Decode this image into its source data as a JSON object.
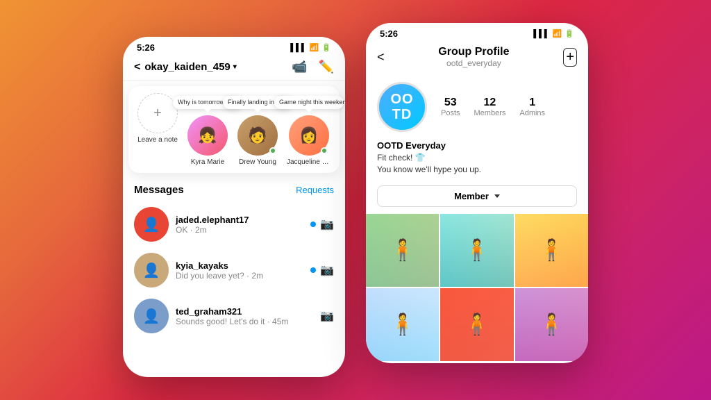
{
  "background": "instagram-gradient",
  "left_phone": {
    "status_bar": {
      "time": "5:26",
      "signal": "▌▌▌",
      "wifi": "WiFi",
      "battery": "Battery"
    },
    "header": {
      "back_label": "<",
      "username": "okay_kaiden_459",
      "dropdown_arrow": "▾",
      "video_icon": "video-camera",
      "compose_icon": "compose"
    },
    "stories": [
      {
        "id": "add",
        "label": "Leave a note",
        "type": "add"
      },
      {
        "id": "kyra",
        "label": "Kyra Marie",
        "note": "Why is tomorrow Monday!? 😅",
        "online": false,
        "avatar_color": "pink"
      },
      {
        "id": "drew",
        "label": "Drew Young",
        "note": "Finally landing in NYC! ❤️",
        "online": true,
        "avatar_color": "brown"
      },
      {
        "id": "jacqueline",
        "label": "Jacqueline Lam",
        "note": "Game night this weekend? 🎮",
        "online": true,
        "avatar_color": "orange"
      }
    ],
    "messages_header": {
      "title": "Messages",
      "requests": "Requests"
    },
    "messages": [
      {
        "username": "jaded.elephant17",
        "preview": "OK · 2m",
        "unread": true,
        "has_camera": true,
        "avatar_color": "#e84535"
      },
      {
        "username": "kyia_kayaks",
        "preview": "Did you leave yet? · 2m",
        "unread": true,
        "has_camera": true,
        "avatar_color": "#c9a97a"
      },
      {
        "username": "ted_graham321",
        "preview": "Sounds good! Let's do it · 45m",
        "unread": false,
        "has_camera": true,
        "avatar_color": "#7a9ec9"
      }
    ]
  },
  "right_phone": {
    "status_bar": {
      "time": "5:26",
      "signal": "▌▌▌",
      "wifi": "WiFi",
      "battery": "Battery"
    },
    "header": {
      "back_icon": "back-arrow",
      "title": "Group Profile",
      "subtitle": "ootd_everyday",
      "add_icon": "plus-square"
    },
    "group": {
      "avatar_line1": "OO",
      "avatar_line2": "TD",
      "stats": [
        {
          "num": "53",
          "label": "Posts"
        },
        {
          "num": "12",
          "label": "Members"
        },
        {
          "num": "1",
          "label": "Admins"
        }
      ],
      "name": "OOTD Everyday",
      "bio_line1": "Fit check! 👕",
      "bio_line2": "You know we'll hype you up.",
      "member_button": "Member",
      "member_dropdown": "▾"
    },
    "photos": [
      {
        "id": "p1",
        "color_class": "p1"
      },
      {
        "id": "p2",
        "color_class": "p2"
      },
      {
        "id": "p3",
        "color_class": "p3"
      },
      {
        "id": "p4",
        "color_class": "p4"
      },
      {
        "id": "p5",
        "color_class": "p5"
      },
      {
        "id": "p6",
        "color_class": "p6"
      }
    ]
  }
}
